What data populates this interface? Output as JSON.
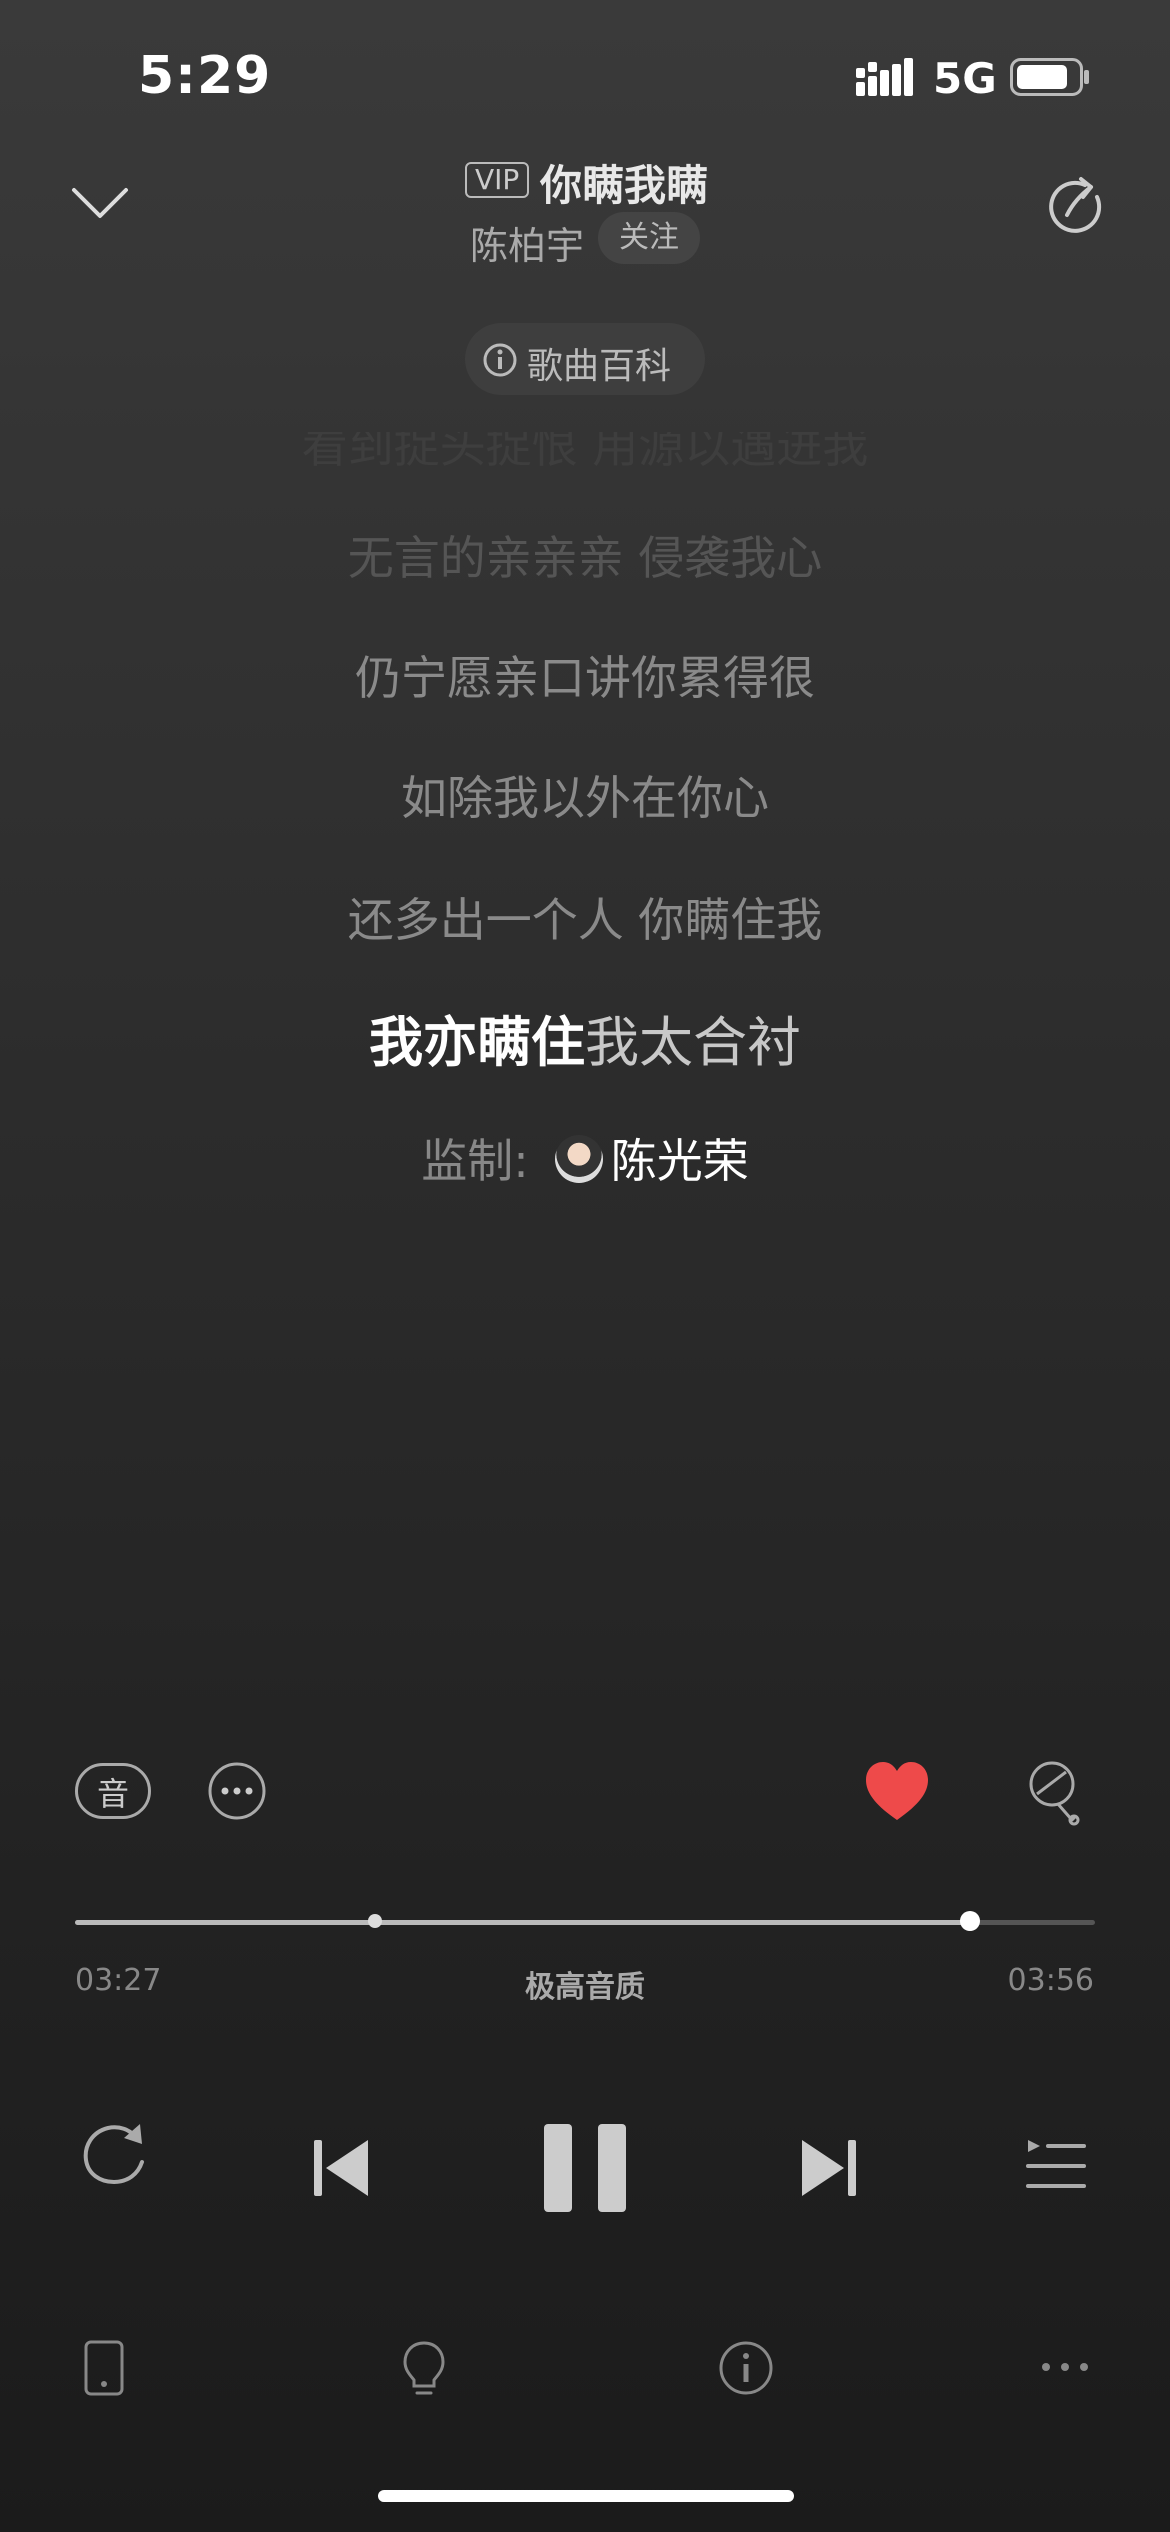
{
  "status_bar": {
    "time": "5:29",
    "network": "5G"
  },
  "header": {
    "vip_badge": "VIP",
    "song_title": "你瞒我瞒",
    "artist": "陈柏宇",
    "follow_label": "关注",
    "baike_label": "歌曲百科"
  },
  "lyrics": {
    "line0": "看到捉头捉恨 用源以遇进我",
    "line1": "无言的亲亲亲 侵袭我心",
    "line2": "仍宁愿亲口讲你累得很",
    "line3": "如除我以外在你心",
    "line4": "还多出一个人 你瞒住我",
    "current_sung": "我亦瞒住",
    "current_rest": "我太合衬",
    "producer_label": "监制:",
    "producer_name": "陈光荣"
  },
  "actions": {
    "sound_effect_label": "音",
    "liked": true
  },
  "progress": {
    "current_time": "03:27",
    "total_time": "03:56",
    "quality_label": "极高音质",
    "played_fraction": 0.877,
    "chorus_marker_fraction": 0.294
  },
  "colors": {
    "heart": "#ee4a4a",
    "background": "#2d2d2d"
  },
  "controls": {
    "icons": [
      "repeat-icon",
      "previous-icon",
      "pause-icon",
      "next-icon",
      "playlist-icon"
    ]
  },
  "toolbar": {
    "icons": [
      "device-icon",
      "lightbulb-icon",
      "info-icon",
      "more-dots-icon"
    ]
  }
}
